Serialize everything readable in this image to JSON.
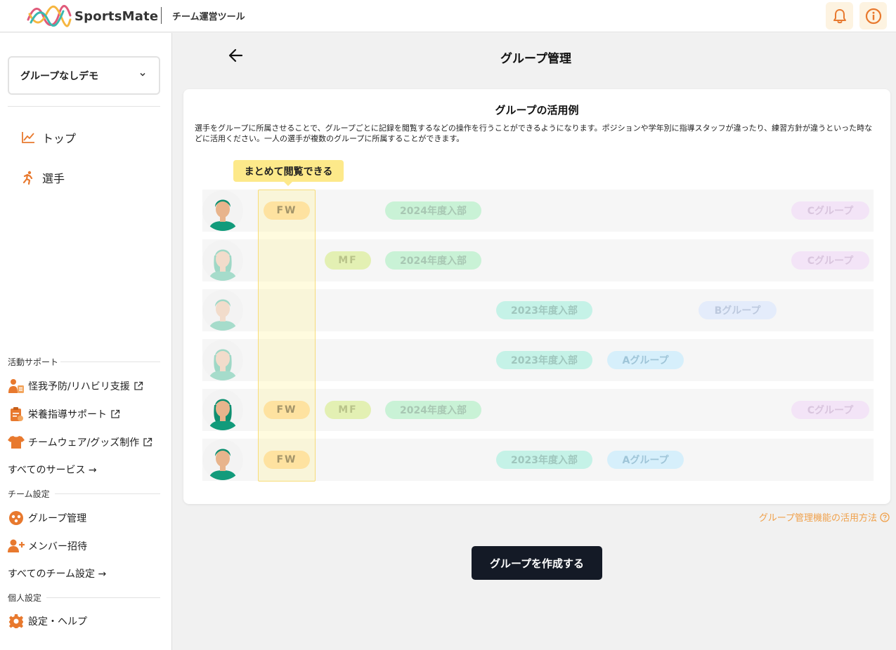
{
  "header": {
    "logo_text": "SportsMate",
    "app_name": "チーム運営ツール"
  },
  "sidebar": {
    "group_selector": "グループなしデモ",
    "nav": [
      {
        "label": "トップ",
        "icon": "chart-line-icon"
      },
      {
        "label": "選手",
        "icon": "runner-icon"
      }
    ],
    "sections": {
      "support_label": "活動サポート",
      "support_items": [
        {
          "label": "怪我予防/リハビリ支援",
          "icon": "injury-support-icon"
        },
        {
          "label": "栄養指導サポート",
          "icon": "clipboard-icon"
        },
        {
          "label": "チームウェア/グッズ制作",
          "icon": "tshirt-icon"
        }
      ],
      "all_services": "すべてのサービス →",
      "team_label": "チーム設定",
      "team_items": [
        {
          "label": "グループ管理",
          "icon": "group-icon"
        },
        {
          "label": "メンバー招待",
          "icon": "add-user-icon"
        }
      ],
      "all_team_settings": "すべてのチーム設定 →",
      "personal_label": "個人設定",
      "personal_items": [
        {
          "label": "設定・ヘルプ",
          "icon": "gear-icon"
        }
      ]
    }
  },
  "main": {
    "title": "グループ管理",
    "card": {
      "title": "グループの活用例",
      "description": "選手をグループに所属させることで、グループごとに記録を閲覧するなどの操作を行うことができるようになります。ポジションや学年別に指導スタッフが違ったり、練習方針が違うといった時などに活用ください。一人の選手が複数のグループに所属することができます。",
      "callout": "まとめて閲覧できる",
      "rows": [
        {
          "fw": "FW",
          "mf": "",
          "y2024": "2024年度入部",
          "y2023": "",
          "ga": "",
          "gb": "",
          "gc": "Cグループ"
        },
        {
          "fw": "",
          "mf": "MF",
          "y2024": "2024年度入部",
          "y2023": "",
          "ga": "",
          "gb": "",
          "gc": "Cグループ"
        },
        {
          "fw": "",
          "mf": "",
          "y2024": "",
          "y2023": "2023年度入部",
          "ga": "",
          "gb": "Bグループ",
          "gc": ""
        },
        {
          "fw": "",
          "mf": "",
          "y2024": "",
          "y2023": "2023年度入部",
          "ga": "Aグループ",
          "gb": "",
          "gc": ""
        },
        {
          "fw": "FW",
          "mf": "MF",
          "y2024": "2024年度入部",
          "y2023": "",
          "ga": "",
          "gb": "",
          "gc": "Cグループ"
        },
        {
          "fw": "FW",
          "mf": "",
          "y2024": "",
          "y2023": "2023年度入部",
          "ga": "Aグループ",
          "gb": "",
          "gc": ""
        }
      ]
    },
    "help_link": "グループ管理機能の活用方法",
    "create_button": "グループを作成する"
  },
  "colors": {
    "accent": "#e8792e",
    "button_dark": "#141a26",
    "link_orange": "#f0a04a"
  }
}
